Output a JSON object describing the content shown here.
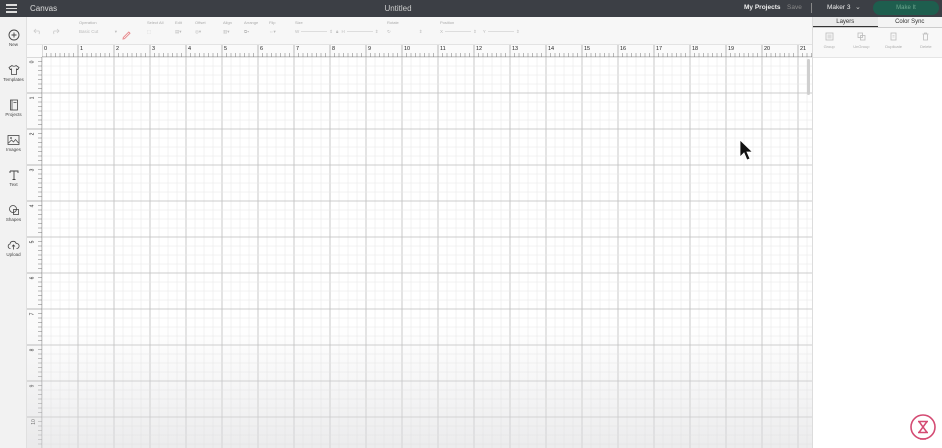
{
  "app": {
    "title": "Canvas",
    "document_title": "Untitled"
  },
  "topbar": {
    "my_projects": "My Projects",
    "save": "Save",
    "machine": "Maker 3",
    "make_button": "Make It"
  },
  "sidebar": {
    "items": [
      {
        "label": "New",
        "icon": "plus-circle-icon"
      },
      {
        "label": "Templates",
        "icon": "shirt-icon"
      },
      {
        "label": "Projects",
        "icon": "book-icon"
      },
      {
        "label": "Images",
        "icon": "image-icon"
      },
      {
        "label": "Text",
        "icon": "text-icon"
      },
      {
        "label": "Shapes",
        "icon": "shapes-icon"
      },
      {
        "label": "Upload",
        "icon": "upload-cloud-icon"
      }
    ]
  },
  "toolbar": {
    "operation_label": "Operation",
    "operation_value": "Basic Cut",
    "select_all_label": "Select All",
    "edit_label": "Edit",
    "offset_label": "Offset",
    "align_label": "Align",
    "arrange_label": "Arrange",
    "flip_label": "Flip",
    "size_label": "Size",
    "size_w": "W",
    "size_h": "H",
    "rotate_label": "Rotate",
    "position_label": "Position",
    "position_x": "X",
    "position_y": "Y"
  },
  "right_panel": {
    "tabs": [
      "Layers",
      "Color Sync"
    ],
    "actions": [
      "Group",
      "UnGroup",
      "Duplicate",
      "Delete"
    ]
  },
  "ruler": {
    "horizontal": [
      "0",
      "1",
      "2",
      "3",
      "4",
      "5",
      "6",
      "7",
      "8",
      "9",
      "10",
      "11",
      "12",
      "13",
      "14",
      "15",
      "16",
      "17",
      "18",
      "19",
      "20",
      "21"
    ],
    "vertical": [
      "0",
      "1",
      "2",
      "3",
      "4",
      "5",
      "6",
      "7",
      "8",
      "9",
      "10"
    ]
  }
}
